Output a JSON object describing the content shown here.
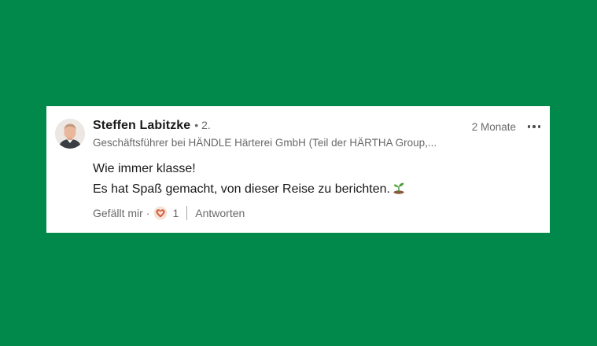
{
  "comment": {
    "author_name": "Steffen Labitzke",
    "connection_degree": "• 2.",
    "headline": "Geschäftsführer bei HÄNDLE Härterei GmbH (Teil der HÄRTHA Group,...",
    "timestamp": "2 Monate",
    "body_line_1": "Wie immer klasse!",
    "body_line_2": "Es hat Spaß gemacht, von dieser Reise zu berichten.",
    "actions": {
      "like_label": "Gefällt mir",
      "separator": "·",
      "reaction_count": "1",
      "reply_label": "Antworten"
    }
  },
  "icons": {
    "avatar": "profile-photo",
    "more": "ellipsis-icon",
    "reaction": "heart-icon",
    "emoji": "seedling-icon"
  },
  "colors": {
    "background": "#00894a",
    "card": "#ffffff",
    "heart": "#e06c4a"
  }
}
